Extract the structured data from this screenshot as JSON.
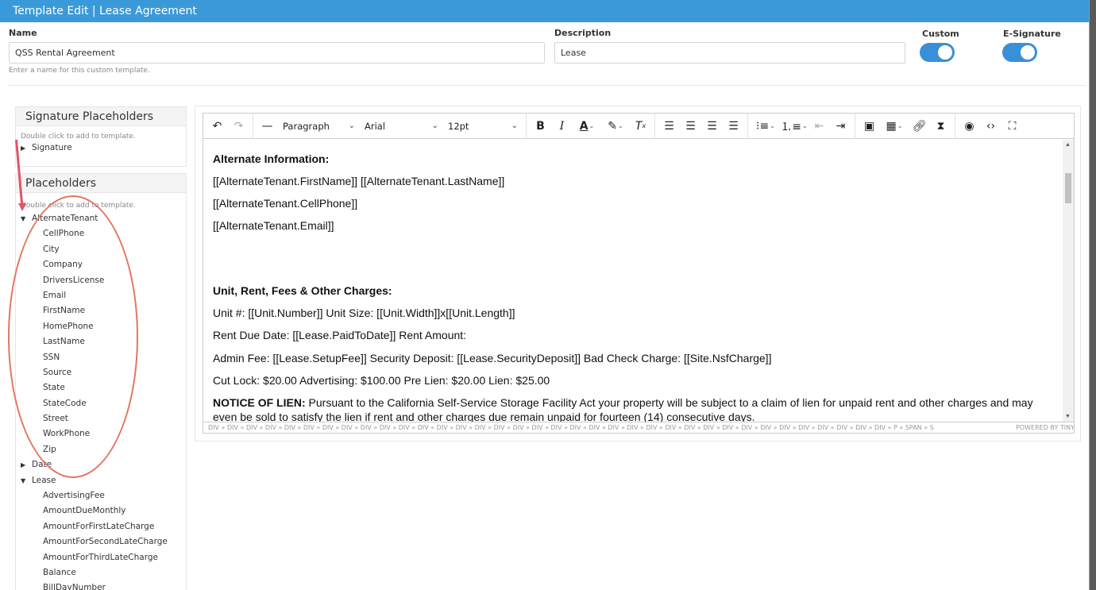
{
  "window": {
    "title": "Template Edit | Lease Agreement"
  },
  "form": {
    "name_label": "Name",
    "name_value": "QSS Rental Agreement",
    "name_hint": "Enter a name for this custom template.",
    "description_label": "Description",
    "description_value": "Lease",
    "custom_label": "Custom",
    "custom_on": true,
    "esignature_label": "E-Signature",
    "esignature_on": true
  },
  "signature_panel": {
    "title": "Signature Placeholders",
    "hint": "Double click to add to template.",
    "items": [
      {
        "label": "Signature",
        "expanded": false
      }
    ]
  },
  "placeholders_panel": {
    "title": "Placeholders",
    "hint": "Double click to add to template.",
    "groups": [
      {
        "label": "AlternateTenant",
        "expanded": true,
        "children": [
          "CellPhone",
          "City",
          "Company",
          "DriversLicense",
          "Email",
          "FirstName",
          "HomePhone",
          "LastName",
          "SSN",
          "Source",
          "State",
          "StateCode",
          "Street",
          "WorkPhone",
          "Zip"
        ]
      },
      {
        "label": "Date",
        "expanded": false,
        "children": []
      },
      {
        "label": "Lease",
        "expanded": true,
        "children": [
          "AdvertisingFee",
          "AmountDueMonthly",
          "AmountForFirstLateCharge",
          "AmountForSecondLateCharge",
          "AmountForThirdLateCharge",
          "Balance",
          "BillDayNumber"
        ]
      }
    ]
  },
  "toolbar": {
    "block_format": "Paragraph",
    "font_family": "Arial",
    "font_size": "12pt",
    "icons": [
      "undo-icon",
      "redo-icon",
      "horizontal-line-icon",
      "bold-icon",
      "italic-icon",
      "text-color-icon",
      "highlight-icon",
      "clear-format-icon",
      "align-left-icon",
      "align-center-icon",
      "align-right-icon",
      "justify-icon",
      "bullet-list-icon",
      "numbered-list-icon",
      "outdent-icon",
      "indent-icon",
      "image-icon",
      "table-icon",
      "link-icon",
      "page-break-icon",
      "preview-icon",
      "source-code-icon",
      "fullscreen-icon"
    ]
  },
  "document": {
    "p1": "Alternate Information:",
    "p2": "[[AlternateTenant.FirstName]] [[AlternateTenant.LastName]]",
    "p3": "[[AlternateTenant.CellPhone]]",
    "p4": "[[AlternateTenant.Email]]",
    "p5": "Unit, Rent, Fees & Other Charges:",
    "p6": "Unit #: [[Unit.Number]] Unit Size: [[Unit.Width]]x[[Unit.Length]]",
    "p7": "Rent Due Date: [[Lease.PaidToDate]] Rent Amount:",
    "p8": "Admin Fee: [[Lease.SetupFee]] Security Deposit: [[Lease.SecurityDeposit]] Bad Check Charge: [[Site.NsfCharge]]",
    "p9": "Cut Lock: $20.00 Advertising: $100.00 Pre Lien: $20.00 Lien: $25.00",
    "p10_bold": "NOTICE OF LIEN:",
    "p10_text": " Pursuant to the California Self-Service Storage Facility Act your property will be subject to a claim of lien for unpaid rent and other charges and may even be sold to satisfy the lien if rent and other charges  due remain unpaid for fourteen (14) consecutive days."
  },
  "statusbar": {
    "path": "DIV » DIV » DIV » DIV » DIV » DIV » DIV » DIV » DIV » DIV » DIV » DIV » DIV » DIV » DIV » DIV » DIV » DIV » DIV » DIV » DIV » DIV » DIV » DIV » DIV » DIV » DIV » DIV » DIV » DIV » DIV » DIV » DIV » DIV » DIV » DIV » P » SPAN » S",
    "powered": "POWERED BY TINY"
  },
  "colors": {
    "titlebar": "#3a9ad9",
    "toggle": "#3a8fd9",
    "annotation_oval": "#e2775f",
    "annotation_arrow": "#e05565"
  }
}
